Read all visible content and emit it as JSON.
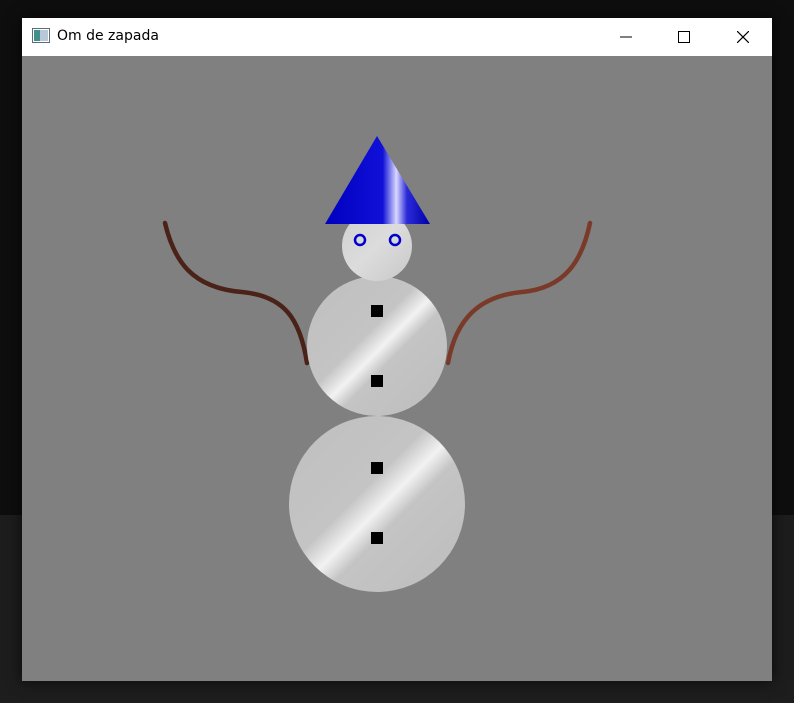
{
  "window": {
    "title": "Om de zapada",
    "icon": "application-icon",
    "controls": [
      "minimize-icon",
      "maximize-icon",
      "close-icon"
    ]
  },
  "scene": {
    "background_color": "#808080",
    "snow_color": "#c0c0c0",
    "hat_color": "#0000cc",
    "eye_color": "#0000cc",
    "button_color": "#000000",
    "arm_color_left": "#4a2218",
    "arm_color_right": "#7a3a2a"
  },
  "taskbar": {
    "color": "#1d1d1d"
  }
}
